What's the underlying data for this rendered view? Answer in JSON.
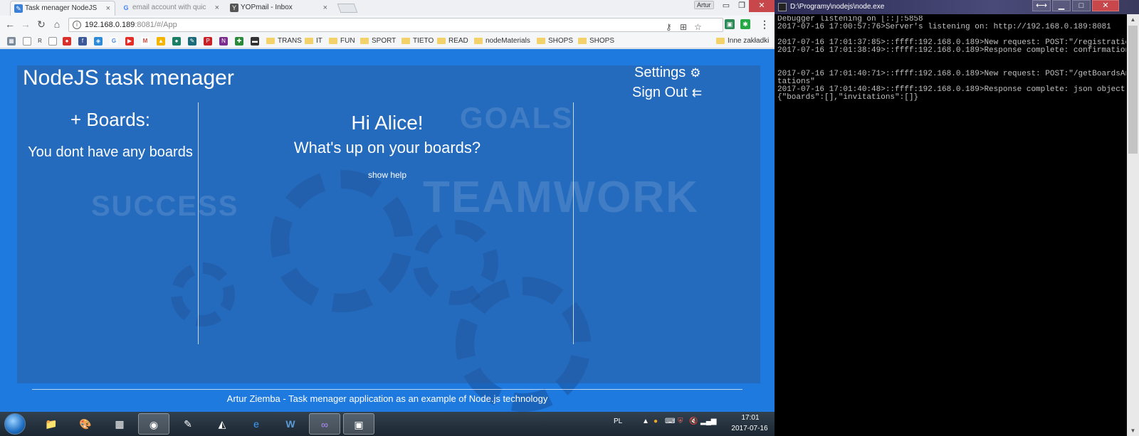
{
  "browser": {
    "tabs": [
      {
        "title": "Task menager NodeJS",
        "icon": "app-favicon",
        "color": "#3b7fd6"
      },
      {
        "title": "email account with quic",
        "icon": "google-favicon",
        "color": "#4285f4"
      },
      {
        "title": "YOPmail - Inbox",
        "icon": "yopmail-favicon",
        "color": "#555555"
      }
    ],
    "user_badge": "Artur",
    "url_host": "192.168.0.189",
    "url_rest": ":8081/#/App",
    "bookmark_folders": [
      "TRANS",
      "IT",
      "FUN",
      "SPORT",
      "TIETO",
      "READ",
      "nodeMaterials",
      "SHOPS",
      "SHOPS"
    ],
    "other_bookmarks": "Inne zakładki",
    "bookmark_r": "R"
  },
  "app": {
    "title": "NodeJS task menager",
    "settings_label": "Settings",
    "signout_label": "Sign Out",
    "boards_heading": "+ Boards:",
    "no_boards_text": "You dont have any boards",
    "greeting": "Hi Alice!",
    "subgreeting": "What's up on your boards?",
    "show_help": "show help",
    "footer": "Artur Ziemba - Task menager application as an example of Node.js technology",
    "background_words": [
      "GOALS",
      "TEAMWORK",
      "SUCCESS"
    ]
  },
  "taskbar": {
    "lang": "PL",
    "time": "17:01",
    "date": "2017-07-16"
  },
  "console": {
    "title": "D:\\Programy\\nodejs\\node.exe",
    "lines": [
      "Debugger listening on [::]:5858",
      "2017-07-16 17:00:57:76>Server's listening on: http://192.168.0.189:8081",
      "",
      "2017-07-16 17:01:37:85>::ffff:192.168.0.189>New request: POST:\"/registration",
      "2017-07-16 17:01:38:49>::ffff:192.168.0.189>Response complete: confirmation",
      "",
      "",
      "2017-07-16 17:01:40:71>::ffff:192.168.0.189>New request: POST:\"/getBoardsAnd",
      "tations\"",
      "2017-07-16 17:01:40:48>::ffff:192.168.0.189>Response complete: json object:",
      "{\"boards\":[],\"invitations\":[]}"
    ]
  },
  "colors": {
    "page_bg": "#1f7ae0",
    "panel": "#285ca0",
    "accent_close": "#c7474a"
  }
}
